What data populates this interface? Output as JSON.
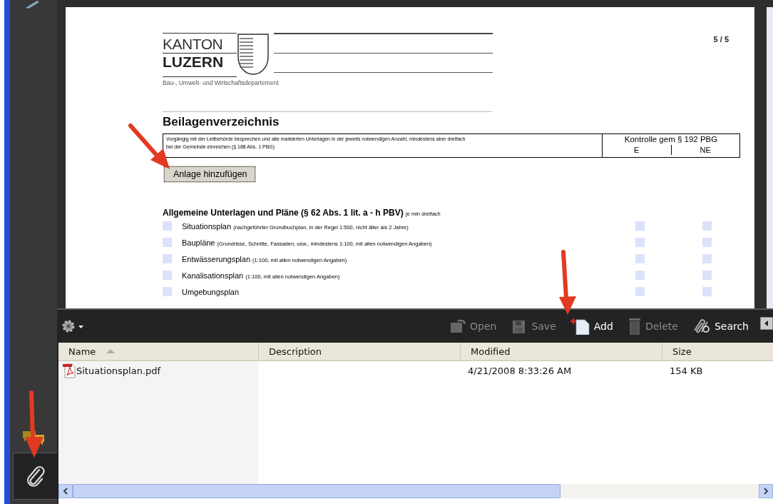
{
  "sidebar": {
    "tabs": [
      {
        "kind": "comments",
        "selected": false
      },
      {
        "kind": "attachments",
        "selected": true
      }
    ]
  },
  "document": {
    "logo": {
      "line1": "KANTON",
      "line2": "LUZERN",
      "department": "Bau-, Umwelt- und Wirtschaftsdepartement"
    },
    "page_number": "5 / 5",
    "title": "Beilagenverzeichnis",
    "instructions": [
      "Vorgängig mit der Leitbehörde besprechen und alle markierten Unterlagen in der jeweils notwendigen Anzahl, mindestens aber dreifach",
      "bei der Gemeinde einreichen (§ 188 Abs. 1 PBG)"
    ],
    "control_heading": "Kontrolle gem § 192 PBG",
    "control_columns": [
      "E",
      "NE"
    ],
    "add_button": "Anlage hinzufügen",
    "section": {
      "heading": "Allgemeine Unterlagen und Pläne (§ 62 Abs. 1 lit. a - h PBV)",
      "note": "je min dreifach",
      "items": [
        {
          "name": "Situationsplan",
          "note": "(nachgeführter Grundbuchplan, in der Regel 1:500, nicht älter als 2 Jahre)",
          "checked": false,
          "e_checked": false,
          "ne_checked": false
        },
        {
          "name": "Baupläne",
          "note": "(Grundrisse, Schnitte, Fassaden, usw., mindestens 1:100, mit allen notwendigen Angaben)",
          "checked": false,
          "e_checked": false,
          "ne_checked": false
        },
        {
          "name": "Entwässerungsplan",
          "note": "(1:100, mit allen notwendigen Angaben)",
          "checked": false,
          "e_checked": false,
          "ne_checked": false
        },
        {
          "name": "Kanalisationsplan",
          "note": "(1:100, mit allen notwendigen Angaben)",
          "checked": false,
          "e_checked": false,
          "ne_checked": false
        },
        {
          "name": "Umgebungsplan",
          "checked": false,
          "e_checked": false,
          "ne_checked": false
        }
      ]
    }
  },
  "attachments_panel": {
    "toolbar": [
      {
        "kind": "open",
        "label": "Open",
        "disabled": true
      },
      {
        "kind": "save",
        "label": "Save",
        "disabled": true
      },
      {
        "kind": "add",
        "label": "Add",
        "disabled": false
      },
      {
        "kind": "delete",
        "label": "Delete",
        "disabled": true
      },
      {
        "kind": "search",
        "label": "Search",
        "disabled": false
      }
    ],
    "columns": [
      {
        "label": "Name",
        "sorted": true
      },
      {
        "label": "Description",
        "sorted": false
      },
      {
        "label": "Modified",
        "sorted": false
      },
      {
        "label": "Size",
        "sorted": false
      }
    ],
    "rows": [
      {
        "name": "Situationsplan.pdf",
        "modified": "4/21/2008 8:33:26 AM",
        "size": "154 KB"
      }
    ]
  }
}
